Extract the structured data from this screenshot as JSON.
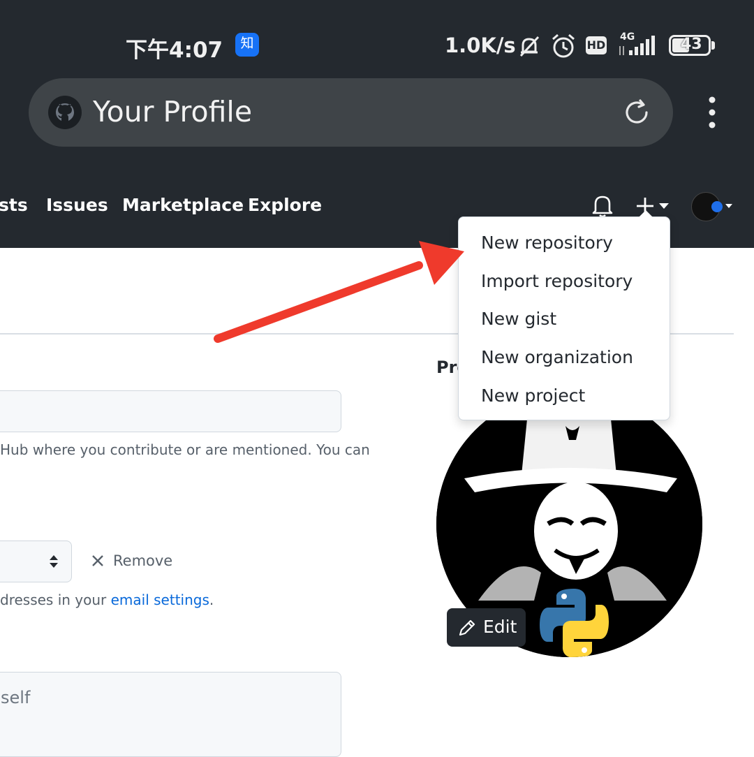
{
  "status_bar": {
    "time": "下午4:07",
    "app_badge": "知",
    "speed": "1.0K/s",
    "network": "4G",
    "hd": "HD",
    "battery": "43"
  },
  "browser": {
    "page_title": "Your Profile"
  },
  "nav": {
    "items": [
      {
        "label": "sts"
      },
      {
        "label": "Issues"
      },
      {
        "label": "Marketplace"
      },
      {
        "label": "Explore"
      }
    ]
  },
  "create_menu": {
    "items": [
      {
        "label": "New repository"
      },
      {
        "label": "Import repository"
      },
      {
        "label": "New gist"
      },
      {
        "label": "New organization"
      },
      {
        "label": "New project"
      }
    ]
  },
  "profile_form": {
    "section_heading_partial": "Pro",
    "email_help": "Hub where you contribute or are mentioned. You can",
    "remove_label": "Remove",
    "email_settings_prefix": "dresses in your ",
    "email_settings_link": "email settings",
    "email_settings_suffix": ".",
    "bio_placeholder": "self",
    "edit_label": "Edit"
  },
  "colors": {
    "header_bg": "#24292f",
    "annotation_arrow": "#ef3a2c",
    "link": "#0969da"
  }
}
